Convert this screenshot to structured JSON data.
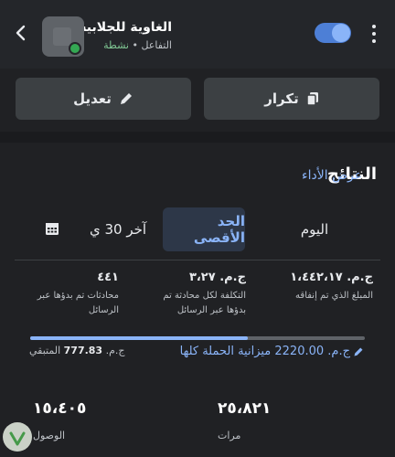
{
  "header": {
    "campaign_name": "الغاوية للجلابية",
    "objective": "التفاعل",
    "separator": "•",
    "status": "نشطة",
    "toggle_on": true,
    "status_color": "#34a853",
    "accent_color": "#8ab4f8"
  },
  "actions": {
    "duplicate_label": "تكرار",
    "edit_label": "تعديل"
  },
  "results": {
    "title": "النتائج",
    "performance_link": "عرض الأداء",
    "segments": {
      "today": "اليوم",
      "maximum": "الحد الأقصى",
      "last30": "آخر 30 ي"
    },
    "selected_segment": "maximum",
    "metrics": [
      {
        "value": "ج.م. ١،٤٤٢،١٧",
        "label": "المبلغ الذي تم إنفاقه"
      },
      {
        "value": "ج.م. ٣،٢٧",
        "label": "التكلفة لكل محادثة تم بدؤها عبر الرسائل"
      },
      {
        "value": "٤٤١",
        "label": "محادثات تم بدؤها عبر الرسائل"
      }
    ],
    "budget": {
      "total_text": "ج.م. 2220.00 ميزانية الحملة كلها",
      "remaining_prefix": "ج.م.",
      "remaining_value": "777.83",
      "remaining_label": "المتبقي",
      "spent_fraction": 0.65
    },
    "stats": [
      {
        "value": "٢٥،٨٢١",
        "label": "مرات"
      },
      {
        "value": "١٥،٤٠٥",
        "label": "الوصول"
      }
    ]
  }
}
